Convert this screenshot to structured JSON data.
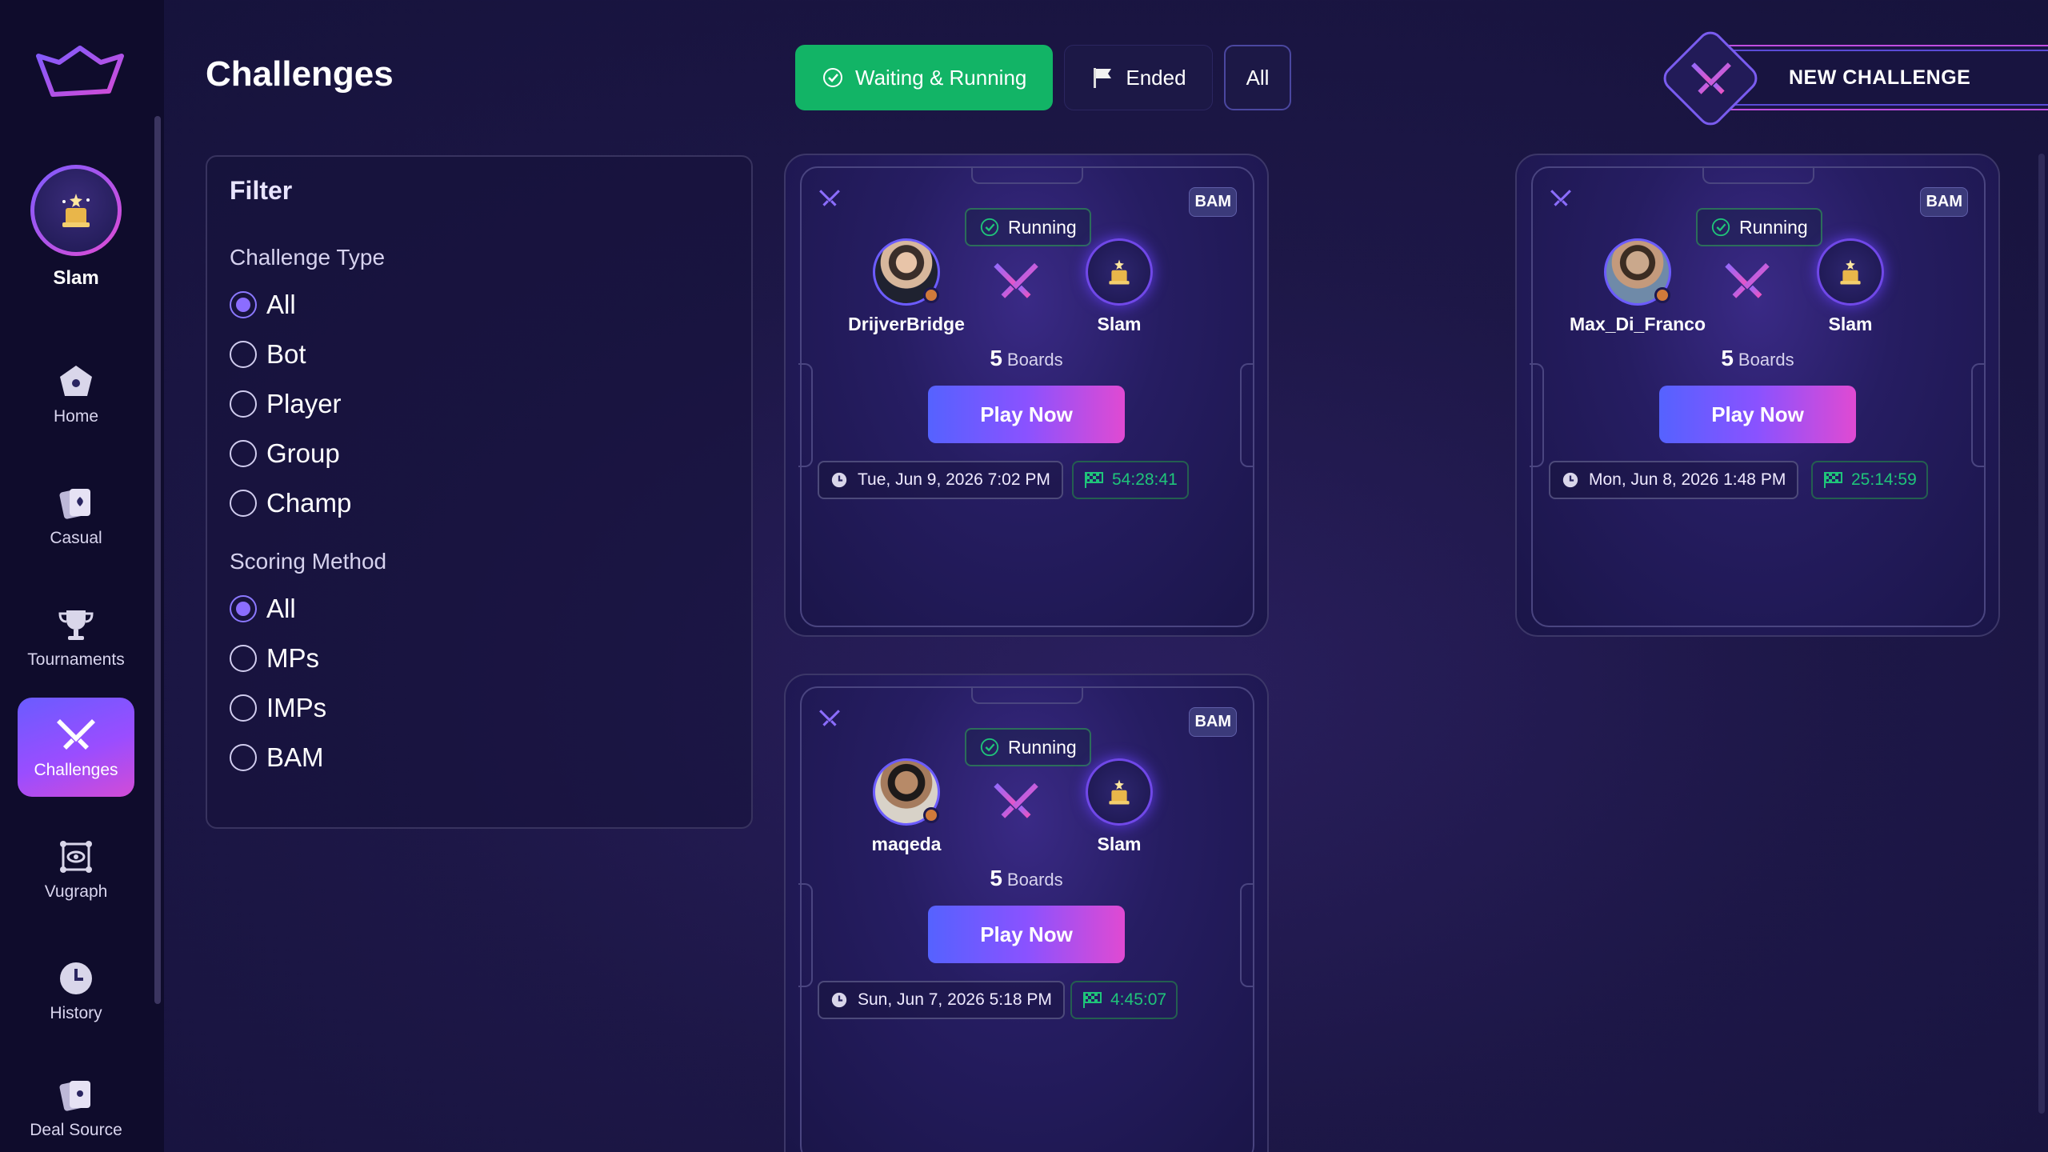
{
  "sidebar": {
    "profile_name": "Slam",
    "items": [
      {
        "label": "Home",
        "icon": "home-icon"
      },
      {
        "label": "Casual",
        "icon": "cards-icon"
      },
      {
        "label": "Tournaments",
        "icon": "trophy-icon"
      },
      {
        "label": "Challenges",
        "icon": "swords-icon",
        "active": true
      },
      {
        "label": "Vugraph",
        "icon": "vugraph-eye-icon"
      },
      {
        "label": "History",
        "icon": "clock-icon"
      },
      {
        "label": "Deal Source",
        "icon": "cards-icon"
      }
    ]
  },
  "header": {
    "title": "Challenges",
    "tabs": [
      {
        "label": "Waiting & Running",
        "active": true
      },
      {
        "label": "Ended",
        "active": false
      },
      {
        "label": "All",
        "active": false
      }
    ],
    "new_challenge_label": "NEW CHALLENGE"
  },
  "filter": {
    "title": "Filter",
    "challenge_type": {
      "label": "Challenge Type",
      "options": [
        "All",
        "Bot",
        "Player",
        "Group",
        "Champ"
      ],
      "selected": "All"
    },
    "scoring_method": {
      "label": "Scoring Method",
      "options": [
        "All",
        "MPs",
        "IMPs",
        "BAM"
      ],
      "selected": "All"
    }
  },
  "cards": [
    {
      "badge": "BAM",
      "status": "Running",
      "player1": "DrijverBridge",
      "player2": "Slam",
      "boards_count": "5",
      "boards_label": "Boards",
      "play_label": "Play Now",
      "date": "Tue, Jun 9, 2026 7:02 PM",
      "timer": "54:28:41"
    },
    {
      "badge": "BAM",
      "status": "Running",
      "player1": "Max_Di_Franco",
      "player2": "Slam",
      "boards_count": "5",
      "boards_label": "Boards",
      "play_label": "Play Now",
      "date": "Mon, Jun 8, 2026 1:48 PM",
      "timer": "25:14:59"
    },
    {
      "badge": "BAM",
      "status": "Running",
      "player1": "maqeda",
      "player2": "Slam",
      "boards_count": "5",
      "boards_label": "Boards",
      "play_label": "Play Now",
      "date": "Sun, Jun 7, 2026 5:18 PM",
      "timer": "4:45:07"
    }
  ],
  "colors": {
    "accent_green": "#12b466",
    "accent_purple": "#8a52ff",
    "accent_pink": "#e04ad2",
    "background": "#1d1747"
  }
}
